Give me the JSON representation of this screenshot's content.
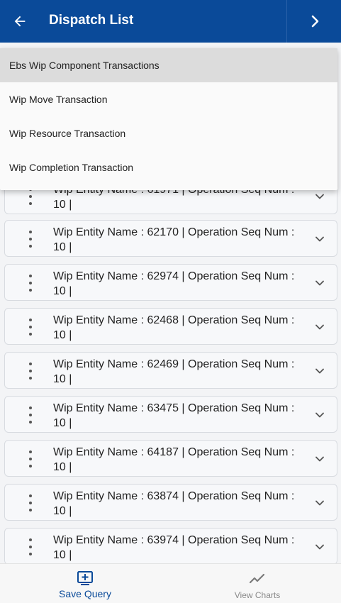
{
  "header": {
    "title": "Dispatch List"
  },
  "menu": {
    "items": [
      "Ebs Wip Component Transactions",
      "Wip Move Transaction",
      "Wip Resource Transaction",
      "Wip Completion Transaction"
    ],
    "selected_index": 0
  },
  "records": [
    {
      "line1": "Wip Entity Name : 61971 | Operation Seq Num :",
      "line2": "10 |"
    },
    {
      "line1": "Wip Entity Name : 62170 | Operation Seq Num :",
      "line2": "10 |"
    },
    {
      "line1": "Wip Entity Name : 62974 | Operation Seq Num :",
      "line2": "10 |"
    },
    {
      "line1": "Wip Entity Name : 62468 | Operation Seq Num :",
      "line2": "10 |"
    },
    {
      "line1": "Wip Entity Name : 62469 | Operation Seq Num :",
      "line2": "10 |"
    },
    {
      "line1": "Wip Entity Name : 63475 | Operation Seq Num :",
      "line2": "10 |"
    },
    {
      "line1": "Wip Entity Name : 64187 | Operation Seq Num :",
      "line2": "10 |"
    },
    {
      "line1": "Wip Entity Name : 63874 | Operation Seq Num :",
      "line2": "10 |"
    },
    {
      "line1": "Wip Entity Name : 63974 | Operation Seq Num :",
      "line2": "10 |"
    }
  ],
  "bottom_nav": {
    "save_query": "Save Query",
    "view_charts": "View Charts"
  },
  "colors": {
    "header_bg": "#0a4a99",
    "active_tab": "#0a4a99",
    "inactive_tab": "#8a8a8a"
  }
}
